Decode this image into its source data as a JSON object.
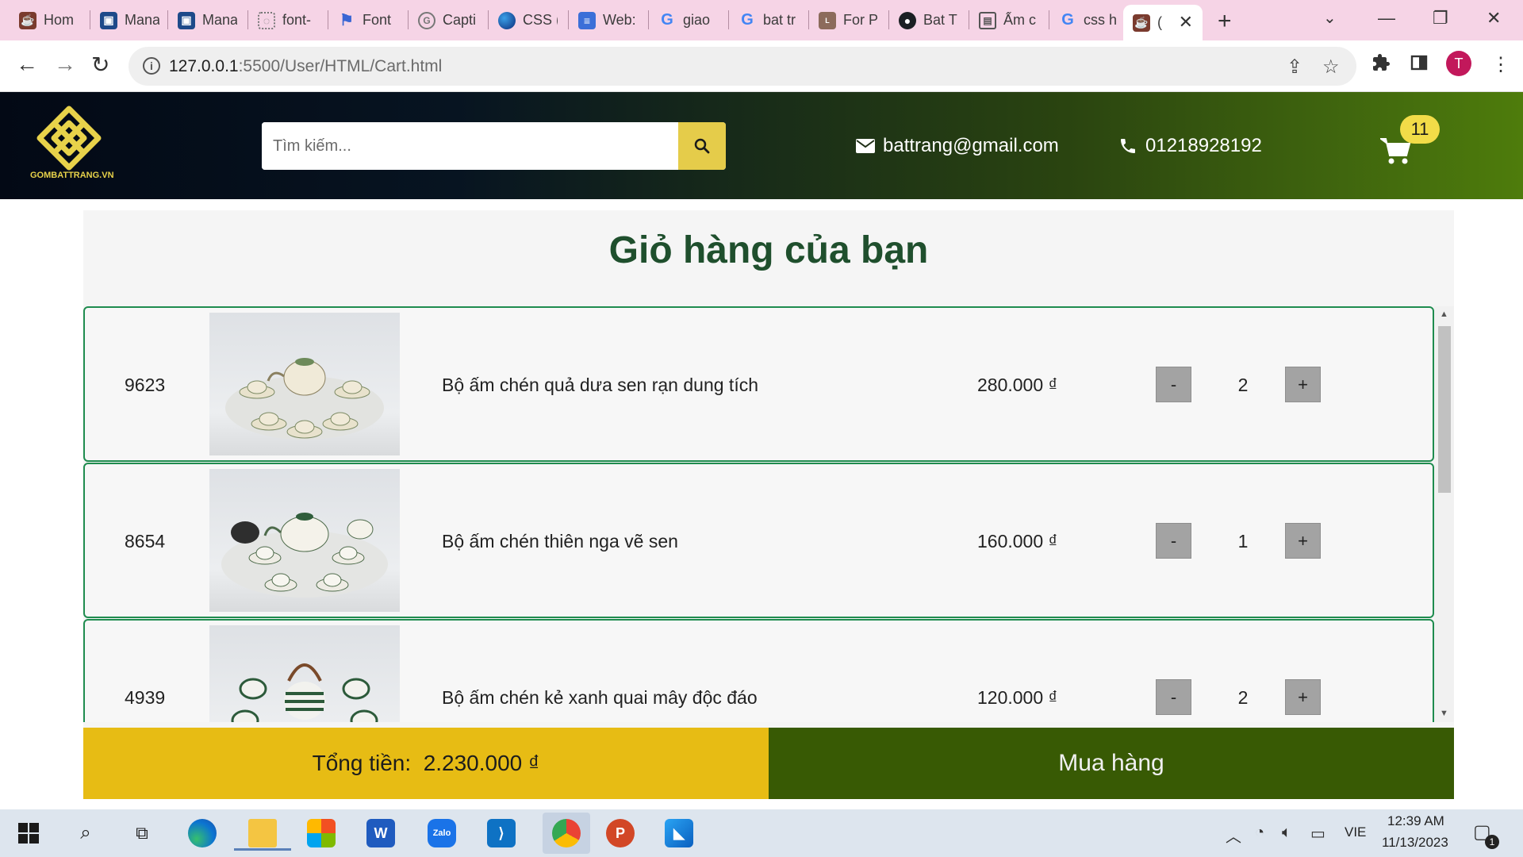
{
  "browser": {
    "tabs": [
      {
        "title": "Hom",
        "icon": "teapot-icon"
      },
      {
        "title": "Mana",
        "icon": "app-icon"
      },
      {
        "title": "Mana",
        "icon": "app-icon"
      },
      {
        "title": "font-",
        "icon": "loading-icon"
      },
      {
        "title": "Font",
        "icon": "flag-icon"
      },
      {
        "title": "Capti",
        "icon": "google-icon"
      },
      {
        "title": "CSS (",
        "icon": "globe-icon"
      },
      {
        "title": "Web:",
        "icon": "docs-icon"
      },
      {
        "title": "giao",
        "icon": "google-icon"
      },
      {
        "title": "bat tr",
        "icon": "google-icon"
      },
      {
        "title": "For P",
        "icon": "lotte-icon"
      },
      {
        "title": "Bat T",
        "icon": "github-icon"
      },
      {
        "title": "Ấm c",
        "icon": "slides-icon"
      },
      {
        "title": "css h",
        "icon": "google-icon"
      },
      {
        "title": "(",
        "icon": "teapot-icon"
      }
    ],
    "url_host": "127.0.0.1",
    "url_path": ":5500/User/HTML/Cart.html"
  },
  "header": {
    "logo_text": "GOMBATTRANG.VN",
    "search_placeholder": "Tìm kiếm...",
    "email": "battrang@gmail.com",
    "phone": "01218928192",
    "cart_count": "11",
    "colors": {
      "accent_yellow": "#e5cc4a",
      "badge": "#f2dc48"
    }
  },
  "cart": {
    "title": "Giỏ hàng của bạn",
    "items": [
      {
        "id": "9623",
        "name": "Bộ ấm chén quả dưa sen rạn dung tích",
        "price": "280.000 ₫",
        "qty": "2"
      },
      {
        "id": "8654",
        "name": "Bộ ấm chén thiên nga vẽ sen",
        "price": "160.000 ₫",
        "qty": "1"
      },
      {
        "id": "4939",
        "name": "Bộ ấm chén kẻ xanh quai mây độc đáo",
        "price": "120.000 ₫",
        "qty": "2"
      }
    ],
    "minus_label": "-",
    "plus_label": "+",
    "total_label": "Tổng tiền:",
    "total_value": "2.230.000 ₫",
    "buy_label": "Mua hàng",
    "colors": {
      "total_bg": "#e7bc14",
      "buy_bg": "#385a04",
      "title": "#1f4f2d",
      "border": "#1f8c4f"
    }
  },
  "taskbar": {
    "time": "12:39 AM",
    "date": "11/13/2023",
    "language": "VIE",
    "notification_count": "1",
    "apps": [
      "windows-start-icon",
      "search-icon",
      "task-view-icon",
      "edge-icon",
      "file-explorer-icon",
      "microsoft-store-icon",
      "word-icon",
      "zalo-icon",
      "vscode-icon",
      "chrome-icon",
      "powerpoint-icon",
      "photos-icon"
    ]
  }
}
